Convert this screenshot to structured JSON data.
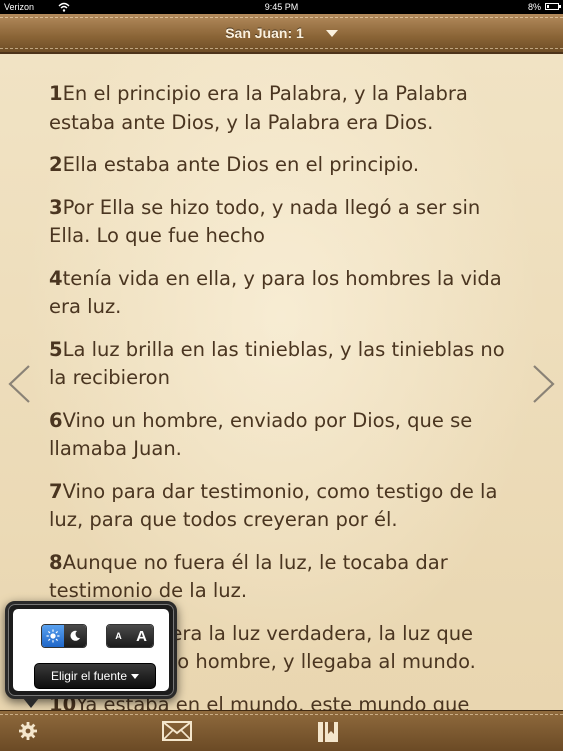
{
  "status_bar": {
    "carrier": "Verizon",
    "time": "9:45 PM",
    "battery": "8%"
  },
  "nav": {
    "chapter_title": "San Juan: 1"
  },
  "verses": [
    {
      "number": "1",
      "text": "En el principio era la Palabra, y la Palabra estaba ante Dios, y la Palabra era Dios."
    },
    {
      "number": "2",
      "text": "Ella estaba ante Dios en el principio."
    },
    {
      "number": "3",
      "text": "Por Ella se hizo todo, y nada llegó a ser sin Ella. Lo que fue hecho"
    },
    {
      "number": "4",
      "text": "tenía vida en ella, y para los hombres la vida era luz."
    },
    {
      "number": "5",
      "text": "La luz brilla en las tinieblas, y las tinieblas no la recibieron"
    },
    {
      "number": "6",
      "text": "Vino un hombre, enviado por Dios, que se llamaba Juan."
    },
    {
      "number": "7",
      "text": "Vino para dar testimonio, como testigo de la luz, para que todos creyeran por él."
    },
    {
      "number": "8",
      "text": "Aunque no fuera él la luz, le tocaba dar testimonio de la luz."
    },
    {
      "number": "9",
      "text": "La Palabra era la luz verdadera, la luz que ilumina a todo hombre, y llegaba al mundo."
    },
    {
      "number": "10",
      "text": "Ya estaba en el mundo, este mundo que"
    }
  ],
  "popover": {
    "size_small": "A",
    "size_large": "A",
    "font_button": "Eligir el fuente"
  },
  "icons": {
    "prev": "chevron-left-icon",
    "next": "chevron-right-icon",
    "settings": "gear-icon",
    "mail": "mail-icon",
    "bookmarks": "bookmark-icon",
    "day_mode": "sun-icon",
    "night_mode": "moon-icon"
  },
  "colors": {
    "accent": "#2f7be0",
    "text": "#4a3520",
    "leather": "#8a6436"
  }
}
